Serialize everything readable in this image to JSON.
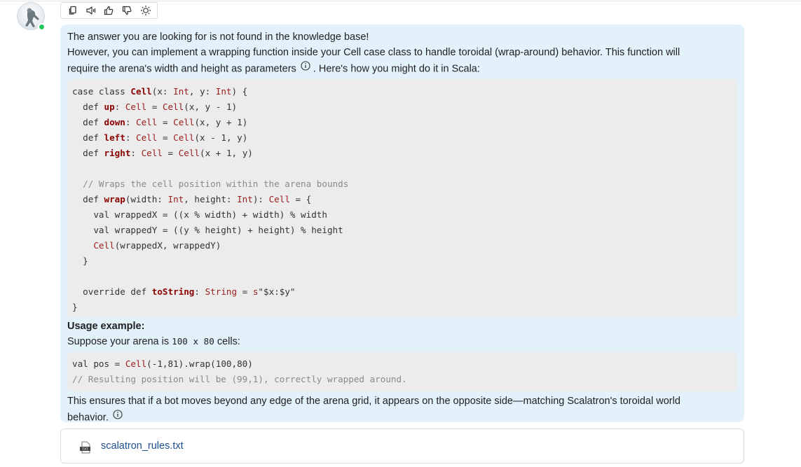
{
  "toolbar": {
    "icons": [
      "copy-icon",
      "speaker-icon",
      "thumbs-up-icon",
      "thumbs-down-icon",
      "bulb-icon"
    ]
  },
  "message": {
    "line1": "The answer you are looking for is not found in the knowledge base!",
    "line2": "However, you can implement a wrapping function inside your Cell case class to handle toroidal (wrap-around) behavior. This function will",
    "line3a": "require the arena's width and height as parameters",
    "line3b": ". Here's how you might do it in Scala:",
    "usage_heading": "Usage example:",
    "suppose_a": "Suppose your arena is ",
    "suppose_code": "100 x 80",
    "suppose_b": " cells:",
    "closing_line1": "This ensures that if a bot moves beyond any edge of the arena grid, it appears on the opposite side—matching Scalatron's toroidal world",
    "closing_line2": "behavior."
  },
  "code_block_1": {
    "lines": [
      "case class Cell(x: Int, y: Int) {",
      "  def up: Cell = Cell(x, y - 1)",
      "  def down: Cell = Cell(x, y + 1)",
      "  def left: Cell = Cell(x - 1, y)",
      "  def right: Cell = Cell(x + 1, y)",
      "",
      "  // Wraps the cell position within the arena bounds",
      "  def wrap(width: Int, height: Int): Cell = {",
      "    val wrappedX = ((x % width) + width) % width",
      "    val wrappedY = ((y % height) + height) % height",
      "    Cell(wrappedX, wrappedY)",
      "  }",
      "",
      "  override def toString: String = s\"$x:$y\"",
      "}"
    ]
  },
  "code_block_2": {
    "lines": [
      "val pos = Cell(-1,81).wrap(100,80)",
      "// Resulting position will be (99,1), correctly wrapped around."
    ]
  },
  "attachment": {
    "icon_label": "TXT",
    "file_name": "scalatron_rules.txt"
  },
  "colors": {
    "bubble_bg": "#e3f1fb",
    "code_bg": "#ececec",
    "status_online": "#22c55e",
    "link": "#1d4f91"
  }
}
